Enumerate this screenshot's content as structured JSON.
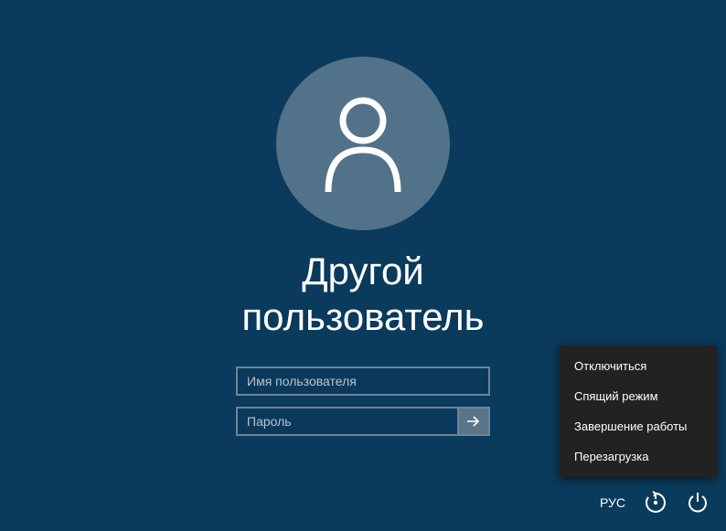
{
  "title": "Другой\nпользователь",
  "fields": {
    "username_placeholder": "Имя пользователя",
    "password_placeholder": "Пароль"
  },
  "power_menu": {
    "items": [
      "Отключиться",
      "Спящий режим",
      "Завершение работы",
      "Перезагрузка"
    ]
  },
  "bottom": {
    "language": "РУС"
  }
}
